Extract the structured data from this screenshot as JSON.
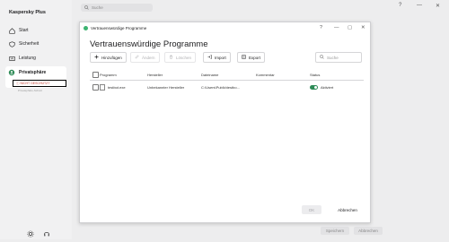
{
  "app": {
    "title": "Kaspersky Plus"
  },
  "sidebar": {
    "items": [
      {
        "label": "Start",
        "icon": "home-icon"
      },
      {
        "label": "Sicherheit",
        "icon": "shield-icon"
      },
      {
        "label": "Leistung",
        "icon": "performance-icon"
      },
      {
        "label": "Privatsphäre",
        "icon": "privacy-icon"
      }
    ],
    "sub_warning": "ⓘ NICHT GESCHÜTZT",
    "sub_caption": "Privatsphäre-Schutz"
  },
  "main": {
    "search_placeholder": "Suche",
    "save_label": "Speichern",
    "cancel_label": "Abbrechen",
    "window_controls": [
      "?",
      "—",
      "✕"
    ]
  },
  "dialog": {
    "window_title": "Vertrauenswürdige Programme",
    "window_controls": [
      "?",
      "—",
      "▢",
      "✕"
    ],
    "heading": "Vertrauenswürdige Programme",
    "toolbar": {
      "add": "Hinzufügen",
      "edit": "Ändern",
      "delete": "Löschen",
      "import": "Import",
      "export": "Export"
    },
    "search_placeholder": "Suche",
    "columns": {
      "program": "Programm",
      "vendor": "Hersteller",
      "filename": "Dateiname",
      "comment": "Kommentar",
      "status": "Status"
    },
    "rows": [
      {
        "program": "testbot.exe",
        "vendor": "Unbekannter Hersteller",
        "filename": "C:\\Users\\Public\\testbo...",
        "comment": "",
        "status": "Aktiviert",
        "enabled": true
      }
    ],
    "ok_label": "OK",
    "cancel_label": "Abbrechen"
  },
  "colors": {
    "accent_green": "#2e8b57",
    "warning_red": "#c0392b"
  }
}
